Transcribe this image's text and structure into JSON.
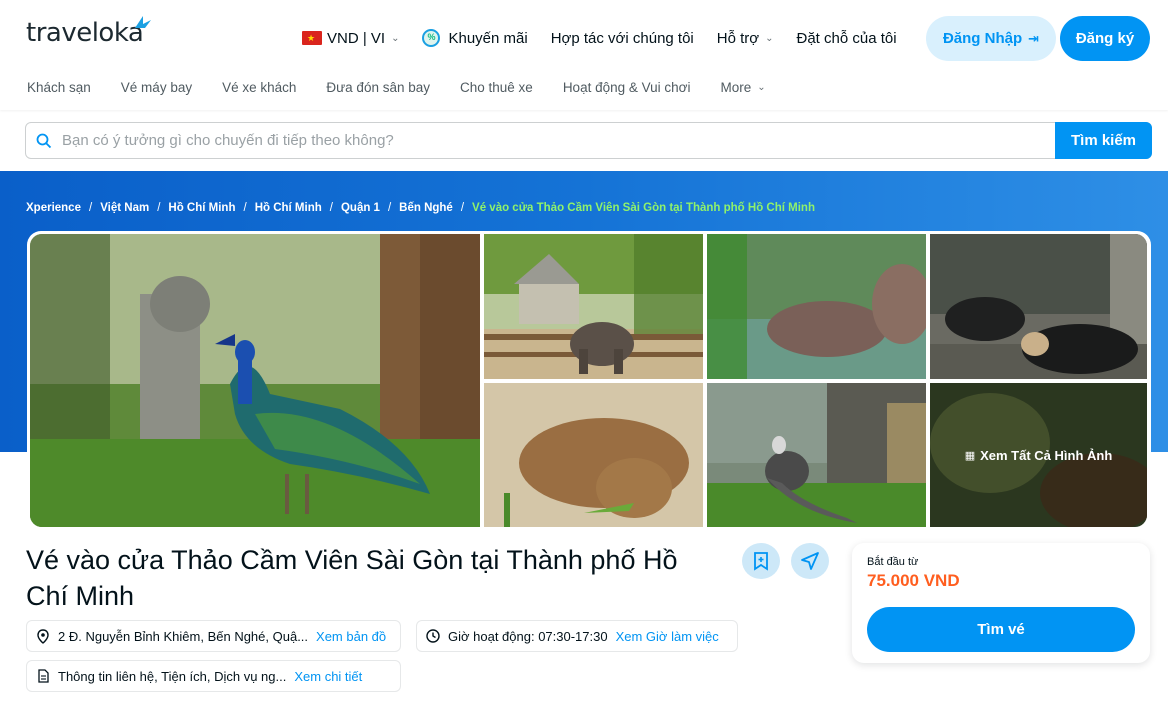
{
  "brand": {
    "logo_text": "traveloka"
  },
  "header": {
    "currency_lang": "VND | VI",
    "nav": {
      "promotions": "Khuyến mãi",
      "partner": "Hợp tác với chúng tôi",
      "support": "Hỗ trợ",
      "my_bookings": "Đặt chỗ của tôi"
    },
    "login_label": "Đăng Nhập",
    "register_label": "Đăng ký",
    "subnav": [
      "Khách sạn",
      "Vé máy bay",
      "Vé xe khách",
      "Đưa đón sân bay",
      "Cho thuê xe",
      "Hoạt động & Vui chơi",
      "More"
    ]
  },
  "search": {
    "placeholder": "Bạn có ý tưởng gì cho chuyến đi tiếp theo không?",
    "button_label": "Tìm kiếm"
  },
  "breadcrumb": [
    "Xperience",
    "Việt Nam",
    "Hồ Chí Minh",
    "Hồ Chí Minh",
    "Quận 1",
    "Bến Nghé",
    "Vé vào cửa Thảo Cầm Viên Sài Gòn tại Thành phố Hồ Chí Minh"
  ],
  "gallery": {
    "see_all_label": "Xem Tất Cả Hình Ảnh",
    "images": [
      "peacock",
      "elephant",
      "hippo",
      "bears",
      "capybara",
      "bird",
      "monkey"
    ]
  },
  "attraction": {
    "title": "Vé vào cửa Thảo Cầm Viên Sài Gòn tại Thành phố Hồ Chí Minh",
    "address": "2 Đ. Nguyễn Bỉnh Khiêm, Bến Nghé, Quậ...",
    "map_link": "Xem bản đồ",
    "hours": "Giờ hoạt động: 07:30-17:30",
    "hours_link": "Xem Giờ làm việc",
    "info": "Thông tin liên hệ, Tiện ích, Dịch vụ ng...",
    "info_link": "Xem chi tiết"
  },
  "price_card": {
    "from_label": "Bắt đầu từ",
    "price": "75.000 VND",
    "button_label": "Tìm vé"
  },
  "colors": {
    "primary": "#0194f3",
    "price": "#ff5e1f",
    "breadcrumb_current": "#8ff26b"
  }
}
